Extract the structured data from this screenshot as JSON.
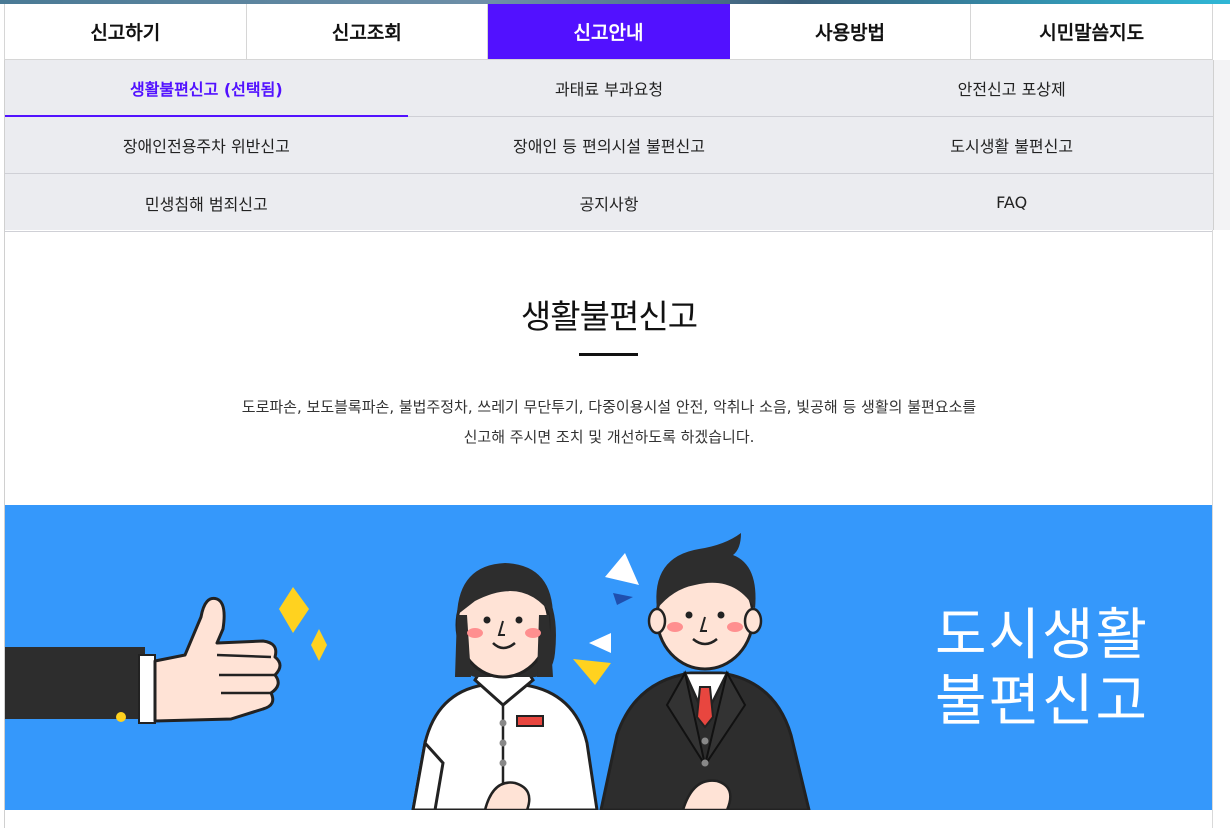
{
  "main_tabs": [
    {
      "label": "신고하기"
    },
    {
      "label": "신고조회"
    },
    {
      "label": "신고안내",
      "active": true
    },
    {
      "label": "사용방법"
    },
    {
      "label": "시민말씀지도"
    }
  ],
  "sub_menu": [
    [
      "생활불편신고 (선택됨)",
      "과태료 부과요청",
      "안전신고 포상제"
    ],
    [
      "장애인전용주차 위반신고",
      "장애인 등 편의시설 불편신고",
      "도시생활 불편신고"
    ],
    [
      "민생침해 범죄신고",
      "공지사항",
      "FAQ"
    ]
  ],
  "content": {
    "title": "생활불편신고",
    "desc_line1": "도로파손, 보도블록파손, 불법주정차, 쓰레기 무단투기, 다중이용시설 안전, 악취나 소음, 빛공해 등 생활의 불편요소를",
    "desc_line2": "신고해 주시면 조치 및 개선하도록 하겠습니다."
  },
  "banner": {
    "text_line1": "도시생활",
    "text_line2": "불편신고",
    "bg_color": "#3598fb"
  },
  "colors": {
    "accent": "#5211ff",
    "submenu_bg": "#ebecf0"
  }
}
